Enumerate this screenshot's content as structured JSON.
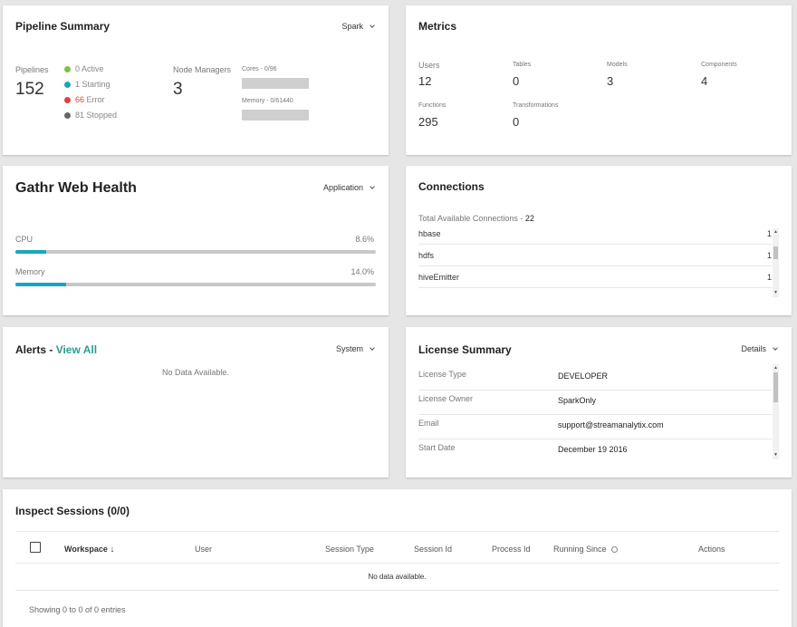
{
  "pipeline": {
    "title": "Pipeline Summary",
    "dropdown": "Spark",
    "pipelines_label": "Pipelines",
    "pipelines_count": "152",
    "statuses": [
      {
        "count": "0",
        "label": "Active",
        "color": "#7cc242"
      },
      {
        "count": "1",
        "label": "Starting",
        "color": "#1aa6bd"
      },
      {
        "count": "66",
        "label": "Error",
        "color": "#e0403d"
      },
      {
        "count": "81",
        "label": "Stopped",
        "color": "#666666"
      }
    ],
    "node_managers_label": "Node Managers",
    "node_managers_count": "3",
    "cores_label": "Cores - 0/96",
    "memory_label": "Memory - 0/61440"
  },
  "metrics": {
    "title": "Metrics",
    "items": [
      {
        "label": "Users",
        "value": "12"
      },
      {
        "label": "Tables",
        "value": "0"
      },
      {
        "label": "Models",
        "value": "3"
      },
      {
        "label": "Components",
        "value": "4"
      },
      {
        "label": "Functions",
        "value": "295"
      },
      {
        "label": "Transformations",
        "value": "0"
      }
    ]
  },
  "health": {
    "title": "Gathr Web Health",
    "dropdown": "Application",
    "cpu_label": "CPU",
    "cpu_value": "8.6%",
    "cpu_fraction": 0.086,
    "memory_label": "Memory",
    "memory_value": "14.0%",
    "memory_fraction": 0.14
  },
  "connections": {
    "title": "Connections",
    "total_label": "Total Available Connections - ",
    "total_value": "22",
    "rows": [
      {
        "name": "hbase",
        "count": "1"
      },
      {
        "name": "hdfs",
        "count": "1"
      },
      {
        "name": "hiveEmitter",
        "count": "1"
      }
    ]
  },
  "alerts": {
    "title": "Alerts - ",
    "view_all": "View All",
    "dropdown": "System",
    "empty": "No Data Available."
  },
  "license": {
    "title": "License Summary",
    "dropdown": "Details",
    "rows": [
      {
        "key": "License Type",
        "value": "DEVELOPER"
      },
      {
        "key": "License Owner",
        "value": "SparkOnly"
      },
      {
        "key": "Email",
        "value": "support@streamanalytix.com"
      },
      {
        "key": "Start Date",
        "value": "December 19 2016"
      }
    ]
  },
  "sessions": {
    "title": "Inspect Sessions (0/0)",
    "columns": {
      "workspace": "Workspace",
      "user": "User",
      "session_type": "Session Type",
      "session_id": "Session Id",
      "process_id": "Process Id",
      "running_since": "Running Since",
      "actions": "Actions"
    },
    "empty": "No data available.",
    "footer": "Showing 0 to 0 of 0 entries"
  }
}
